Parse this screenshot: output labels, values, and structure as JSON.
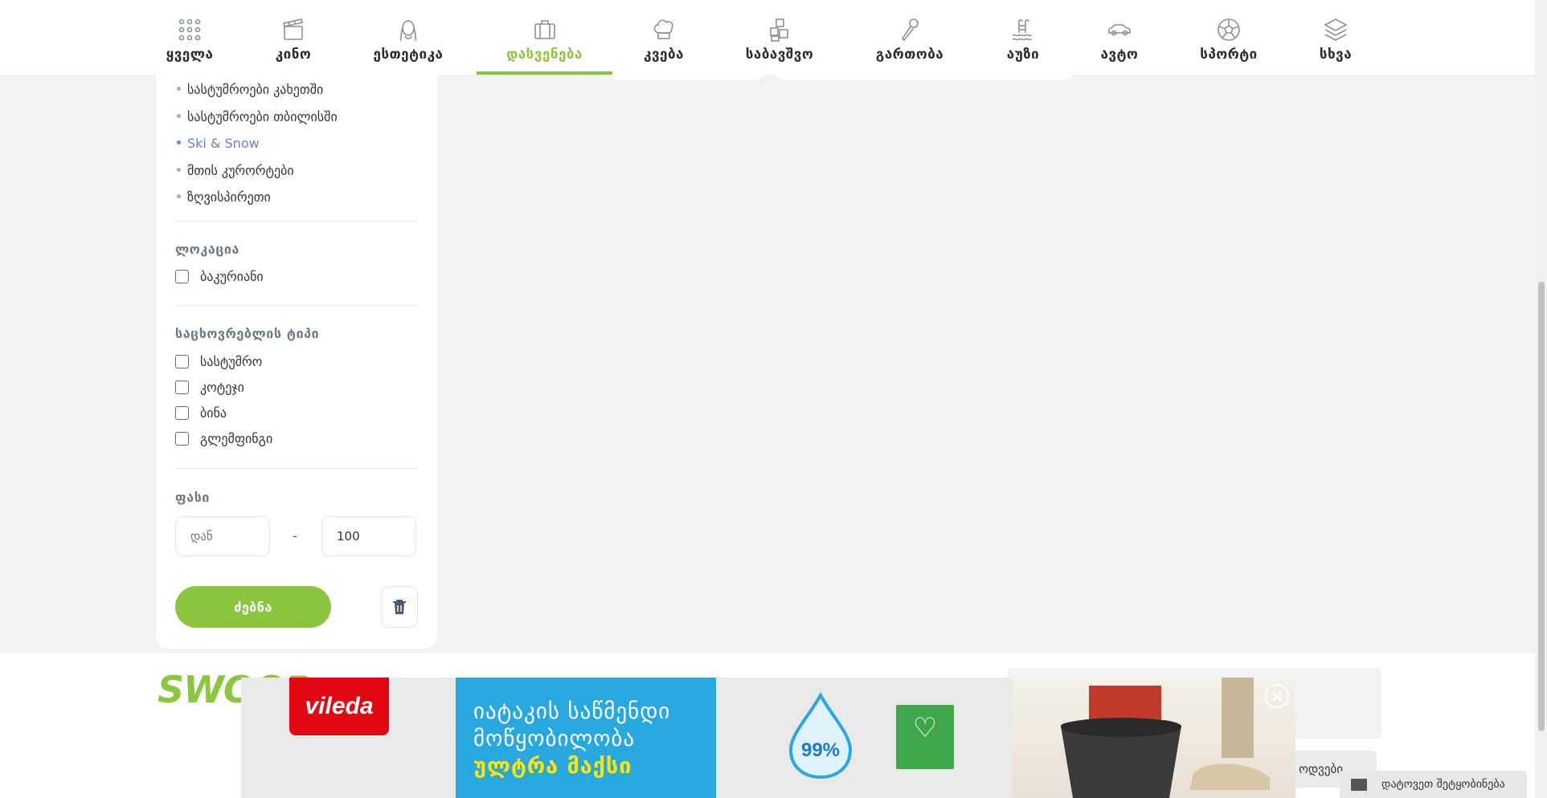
{
  "nav": {
    "items": [
      {
        "label": "ყველა",
        "icon": "grid-icon"
      },
      {
        "label": "კინო",
        "icon": "clapperboard-icon"
      },
      {
        "label": "ესთეტიკა",
        "icon": "woman-face-icon"
      },
      {
        "label": "დასვენება",
        "icon": "suitcase-icon",
        "active": true
      },
      {
        "label": "კვება",
        "icon": "chef-hat-icon"
      },
      {
        "label": "საბავშვო",
        "icon": "toy-blocks-icon"
      },
      {
        "label": "გართობა",
        "icon": "microphone-icon"
      },
      {
        "label": "აუზი",
        "icon": "pool-icon"
      },
      {
        "label": "ავტო",
        "icon": "car-icon"
      },
      {
        "label": "სპორტი",
        "icon": "soccer-ball-icon"
      },
      {
        "label": "სხვა",
        "icon": "layers-icon"
      }
    ],
    "accent_color": "#8cc63f"
  },
  "sidebar": {
    "categories": [
      {
        "label": "სასტუმროები კახეთში"
      },
      {
        "label": "სასტუმროები თბილისში"
      },
      {
        "label": "Ski & Snow",
        "active": true
      },
      {
        "label": "მთის კურორტები"
      },
      {
        "label": "ზღვისპირეთი"
      }
    ],
    "location": {
      "title": "ლოკაცია",
      "options": [
        "ბაკურიანი"
      ]
    },
    "accommodation": {
      "title": "საცხოვრებლის ტიპი",
      "options": [
        "სასტუმრო",
        "კოტეჯი",
        "ბინა",
        "გლემფინგი"
      ]
    },
    "price": {
      "title": "ფასი",
      "from_placeholder": "დან",
      "to_value": "100",
      "separator": "-"
    },
    "search_label": "ძებნა"
  },
  "footer": {
    "logo": "SWOOP"
  },
  "ad": {
    "brand": "vileda",
    "lines": [
      "იატაკის საწმენდი",
      "მოწყობილობა",
      "ულტრა მაქსი"
    ],
    "drop_percent": "99%"
  },
  "message_button": "დატოვეთ შეტყობინება",
  "footer_button_text": "ოდვები"
}
